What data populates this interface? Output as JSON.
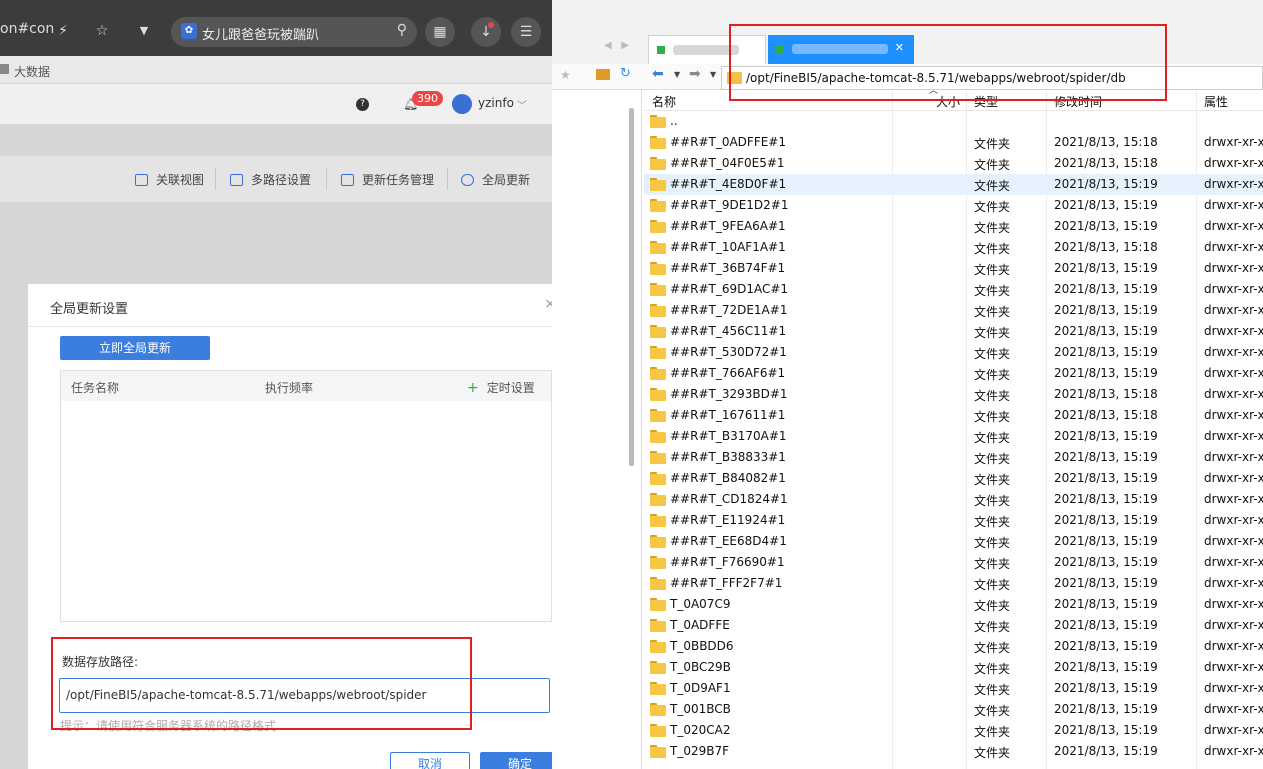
{
  "browser": {
    "url_fragment": "on#con",
    "search_text": "女儿跟爸爸玩被踹趴",
    "bookmark": "大数据"
  },
  "app": {
    "badge_count": "390",
    "username": "yzinfo",
    "toolbar": [
      {
        "label": "关联视图"
      },
      {
        "label": "多路径设置"
      },
      {
        "label": "更新任务管理"
      },
      {
        "label": "全局更新"
      }
    ]
  },
  "dialog": {
    "title": "全局更新设置",
    "update_now_button": "立即全局更新",
    "table_headers": {
      "task_name": "任务名称",
      "frequency": "执行频率",
      "schedule": "定时设置"
    },
    "path_label": "数据存放路径:",
    "path_value": "/opt/FineBI5/apache-tomcat-8.5.71/webapps/webroot/spider",
    "hint": "提示：请使用符合服务器系统的路径格式",
    "cancel": "取消",
    "ok": "确定"
  },
  "explorer": {
    "address": "/opt/FineBI5/apache-tomcat-8.5.71/webapps/webroot/spider/db",
    "columns": {
      "name": "名称",
      "size": "大小",
      "type": "类型",
      "modified": "修改时间",
      "attrs": "属性"
    },
    "rows": [
      {
        "name": "..",
        "type": "",
        "modified": "",
        "attrs": ""
      },
      {
        "name": "##R#T_0ADFFE#1",
        "type": "文件夹",
        "modified": "2021/8/13, 15:18",
        "attrs": "drwxr-xr-x"
      },
      {
        "name": "##R#T_04F0E5#1",
        "type": "文件夹",
        "modified": "2021/8/13, 15:18",
        "attrs": "drwxr-xr-x"
      },
      {
        "name": "##R#T_4E8D0F#1",
        "type": "文件夹",
        "modified": "2021/8/13, 15:19",
        "attrs": "drwxr-xr-x",
        "selected": true
      },
      {
        "name": "##R#T_9DE1D2#1",
        "type": "文件夹",
        "modified": "2021/8/13, 15:19",
        "attrs": "drwxr-xr-x"
      },
      {
        "name": "##R#T_9FEA6A#1",
        "type": "文件夹",
        "modified": "2021/8/13, 15:19",
        "attrs": "drwxr-xr-x"
      },
      {
        "name": "##R#T_10AF1A#1",
        "type": "文件夹",
        "modified": "2021/8/13, 15:18",
        "attrs": "drwxr-xr-x"
      },
      {
        "name": "##R#T_36B74F#1",
        "type": "文件夹",
        "modified": "2021/8/13, 15:19",
        "attrs": "drwxr-xr-x"
      },
      {
        "name": "##R#T_69D1AC#1",
        "type": "文件夹",
        "modified": "2021/8/13, 15:19",
        "attrs": "drwxr-xr-x"
      },
      {
        "name": "##R#T_72DE1A#1",
        "type": "文件夹",
        "modified": "2021/8/13, 15:19",
        "attrs": "drwxr-xr-x"
      },
      {
        "name": "##R#T_456C11#1",
        "type": "文件夹",
        "modified": "2021/8/13, 15:19",
        "attrs": "drwxr-xr-x"
      },
      {
        "name": "##R#T_530D72#1",
        "type": "文件夹",
        "modified": "2021/8/13, 15:19",
        "attrs": "drwxr-xr-x"
      },
      {
        "name": "##R#T_766AF6#1",
        "type": "文件夹",
        "modified": "2021/8/13, 15:19",
        "attrs": "drwxr-xr-x"
      },
      {
        "name": "##R#T_3293BD#1",
        "type": "文件夹",
        "modified": "2021/8/13, 15:18",
        "attrs": "drwxr-xr-x"
      },
      {
        "name": "##R#T_167611#1",
        "type": "文件夹",
        "modified": "2021/8/13, 15:18",
        "attrs": "drwxr-xr-x"
      },
      {
        "name": "##R#T_B3170A#1",
        "type": "文件夹",
        "modified": "2021/8/13, 15:19",
        "attrs": "drwxr-xr-x"
      },
      {
        "name": "##R#T_B38833#1",
        "type": "文件夹",
        "modified": "2021/8/13, 15:19",
        "attrs": "drwxr-xr-x"
      },
      {
        "name": "##R#T_B84082#1",
        "type": "文件夹",
        "modified": "2021/8/13, 15:19",
        "attrs": "drwxr-xr-x"
      },
      {
        "name": "##R#T_CD1824#1",
        "type": "文件夹",
        "modified": "2021/8/13, 15:19",
        "attrs": "drwxr-xr-x"
      },
      {
        "name": "##R#T_E11924#1",
        "type": "文件夹",
        "modified": "2021/8/13, 15:19",
        "attrs": "drwxr-xr-x"
      },
      {
        "name": "##R#T_EE68D4#1",
        "type": "文件夹",
        "modified": "2021/8/13, 15:19",
        "attrs": "drwxr-xr-x"
      },
      {
        "name": "##R#T_F76690#1",
        "type": "文件夹",
        "modified": "2021/8/13, 15:19",
        "attrs": "drwxr-xr-x"
      },
      {
        "name": "##R#T_FFF2F7#1",
        "type": "文件夹",
        "modified": "2021/8/13, 15:19",
        "attrs": "drwxr-xr-x"
      },
      {
        "name": "T_0A07C9",
        "type": "文件夹",
        "modified": "2021/8/13, 15:19",
        "attrs": "drwxr-xr-x"
      },
      {
        "name": "T_0ADFFE",
        "type": "文件夹",
        "modified": "2021/8/13, 15:19",
        "attrs": "drwxr-xr-x"
      },
      {
        "name": "T_0BBDD6",
        "type": "文件夹",
        "modified": "2021/8/13, 15:19",
        "attrs": "drwxr-xr-x"
      },
      {
        "name": "T_0BC29B",
        "type": "文件夹",
        "modified": "2021/8/13, 15:19",
        "attrs": "drwxr-xr-x"
      },
      {
        "name": "T_0D9AF1",
        "type": "文件夹",
        "modified": "2021/8/13, 15:19",
        "attrs": "drwxr-xr-x"
      },
      {
        "name": "T_001BCB",
        "type": "文件夹",
        "modified": "2021/8/13, 15:19",
        "attrs": "drwxr-xr-x"
      },
      {
        "name": "T_020CA2",
        "type": "文件夹",
        "modified": "2021/8/13, 15:19",
        "attrs": "drwxr-xr-x"
      },
      {
        "name": "T_029B7F",
        "type": "文件夹",
        "modified": "2021/8/13, 15:19",
        "attrs": "drwxr-xr-x"
      }
    ]
  }
}
